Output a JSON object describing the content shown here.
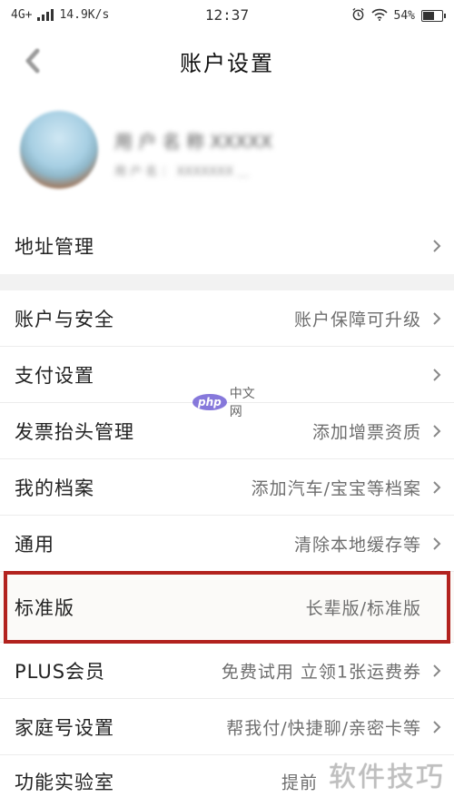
{
  "status_bar": {
    "network": "4G+",
    "speed": "14.9K/s",
    "time": "12:37",
    "battery": "54%",
    "battery_level": 0.54
  },
  "header": {
    "title": "账户设置"
  },
  "profile": {
    "name": "用 户 名 称 XXXXX",
    "account": "用 户 名 ： XXXXXXX ＿"
  },
  "rows": [
    {
      "label": "地址管理",
      "value": ""
    },
    {
      "label": "账户与安全",
      "value": "账户保障可升级"
    },
    {
      "label": "支付设置",
      "value": ""
    },
    {
      "label": "发票抬头管理",
      "value": "添加增票资质"
    },
    {
      "label": "我的档案",
      "value": "添加汽车/宝宝等档案"
    },
    {
      "label": "通用",
      "value": "清除本地缓存等"
    },
    {
      "label": "标准版",
      "value": "长辈版/标准版"
    },
    {
      "label": "PLUS会员",
      "value": "免费试用 立领1张运费券"
    },
    {
      "label": "家庭号设置",
      "value": "帮我付/快捷聊/亲密卡等"
    },
    {
      "label": "功能实验室",
      "value": "提前"
    }
  ],
  "watermarks": {
    "php_badge": "php",
    "php_site": "中文网",
    "brand": "软件技巧"
  },
  "colors": {
    "highlight": "#b2221e",
    "background": "#f2f2f2"
  }
}
